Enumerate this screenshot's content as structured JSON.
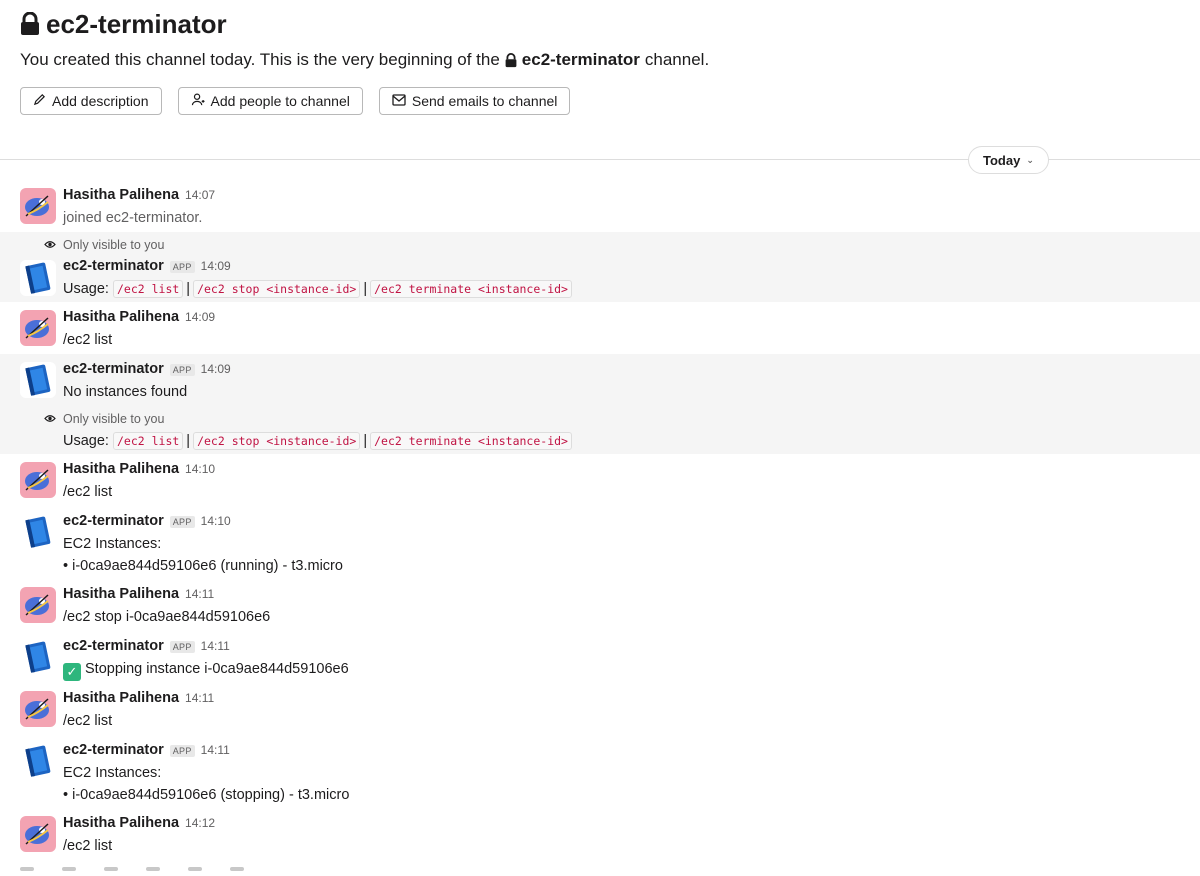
{
  "channel": {
    "name": "ec2-terminator",
    "intro_prefix": "You created this channel today. This is the very beginning of the",
    "intro_channel": "ec2-terminator",
    "intro_suffix": "channel."
  },
  "actions": {
    "add_description": "Add description",
    "add_people": "Add people to channel",
    "send_emails": "Send emails to channel"
  },
  "divider": {
    "label": "Today"
  },
  "visibility_note": "Only visible to you",
  "app_badge": "APP",
  "usage": {
    "label": "Usage:",
    "cmd_list": "/ec2 list",
    "cmd_stop": "/ec2 stop <instance-id>",
    "cmd_terminate": "/ec2 terminate <instance-id>",
    "separator": "|"
  },
  "messages": [
    {
      "author": "Hasitha Palihena",
      "time": "14:07",
      "text": "joined ec2-terminator."
    },
    {
      "author": "ec2-terminator",
      "time": "14:09"
    },
    {
      "author": "Hasitha Palihena",
      "time": "14:09",
      "text": "/ec2 list"
    },
    {
      "author": "ec2-terminator",
      "time": "14:09",
      "text": "No instances found"
    },
    {
      "author": "Hasitha Palihena",
      "time": "14:10",
      "text": "/ec2 list"
    },
    {
      "author": "ec2-terminator",
      "time": "14:10",
      "text": "EC2 Instances:",
      "item": "• i-0ca9ae844d59106e6 (running) - t3.micro"
    },
    {
      "author": "Hasitha Palihena",
      "time": "14:11",
      "text": "/ec2 stop i-0ca9ae844d59106e6"
    },
    {
      "author": "ec2-terminator",
      "time": "14:11",
      "text": "Stopping instance i-0ca9ae844d59106e6"
    },
    {
      "author": "Hasitha Palihena",
      "time": "14:11",
      "text": "/ec2 list"
    },
    {
      "author": "ec2-terminator",
      "time": "14:11",
      "text": "EC2 Instances:",
      "item": "• i-0ca9ae844d59106e6 (stopping) - t3.micro"
    },
    {
      "author": "Hasitha Palihena",
      "time": "14:12",
      "text": "/ec2 list"
    }
  ]
}
